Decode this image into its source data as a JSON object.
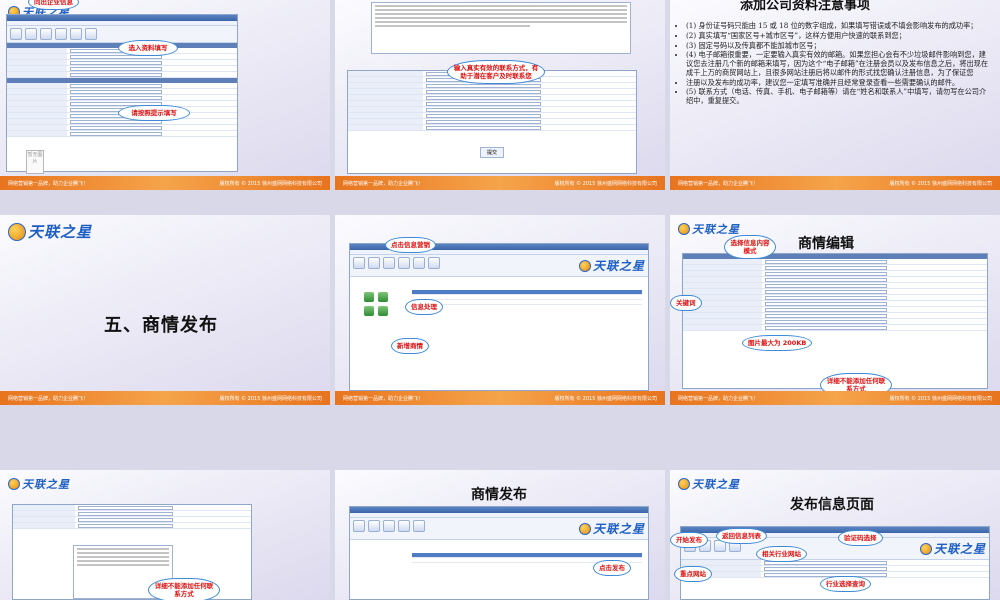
{
  "footer": {
    "left": "网络营销第一品牌，助力企业腾飞！",
    "right": "版权所有 © 2015 徐州盛网网络科技有限公司"
  },
  "brand": {
    "name": "天联之星"
  },
  "s1": {
    "callout_top": "同出企业信息",
    "callout_a": "选入资料填写",
    "callout_b": "请按照提示填写",
    "img_label": "暂无图片"
  },
  "s2": {
    "callout": "输入真实有效的联系方式，有助于潜在客户及时联系您",
    "submit": "提交"
  },
  "s3": {
    "title": "添加公司资料注意事项",
    "items": [
      "(1) 身份证号码只能由 15 或 18 位的数字组成，如果填写错误或不填会影响发布的成功率；",
      "(2) 真实填写“国家区号+城市区号”，这样方便用户快速的联系到您；",
      "(3) 固定号码以及传真都不能加城市区号；",
      "(4) 电子邮箱很重要，一定要输入真实有效的邮箱。如果您担心会有不少垃圾邮件影响到您，建议您去注册几个新的邮箱来填写，因为这个“电子邮箱”在注册会员以及发布信息之后，将出现在成千上万的商贸网站上，且很多网站注册后将以邮件的形式找您确认注册信息，为了保证您",
      "注册以及发布的成功率，建议您一定填写准确并且经常登录查看一些需要确认的邮件。",
      "(5) 联系方式（电话、传真、手机、电子邮箱等）请在“姓名和联系人”中填写，请勿写在公司介绍中，重复提交。"
    ]
  },
  "s4": {
    "title": "五、商情发布"
  },
  "s5": {
    "callout_top": "点击信息营销",
    "callout_mid": "信息处理",
    "callout_new": "新增商情"
  },
  "s6": {
    "title": "商情编辑",
    "c_select": "选择信息内容模式",
    "c_keyword": "关键词",
    "c_image": "图片最大为 200KB",
    "c_detail": "详细不能添加任何联系方式"
  },
  "s7": {
    "c_detail": "详细不能添加任何联系方式"
  },
  "s8": {
    "title": "商情发布",
    "c_publish": "点击发布"
  },
  "s9": {
    "title": "发布信息页面",
    "c_start": "开始发布",
    "c_back": "返回信息列表",
    "c_verify": "验证码选择",
    "c_related": "相关行业网站",
    "c_key": "重点网站",
    "c_industry": "行业选择查询"
  }
}
